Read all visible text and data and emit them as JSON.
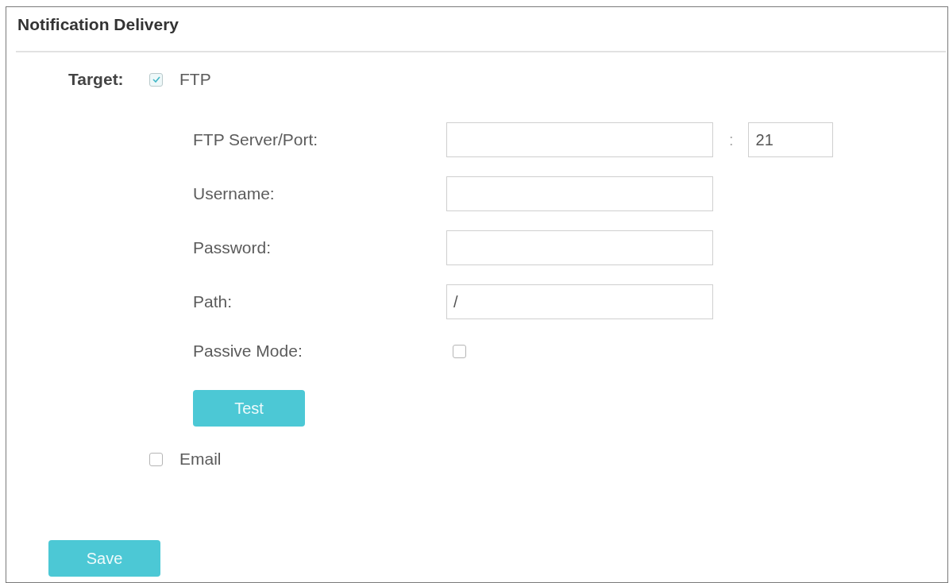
{
  "panel": {
    "title": "Notification Delivery"
  },
  "target": {
    "label": "Target:",
    "options": [
      {
        "label": "FTP",
        "checked": true,
        "fields": [
          {
            "kind": "server_port",
            "label": "FTP Server/Port:",
            "separator": ":",
            "port": "21"
          },
          {
            "kind": "text",
            "label": "Username:"
          },
          {
            "kind": "text",
            "label": "Password:"
          },
          {
            "kind": "text",
            "label": "Path:",
            "value": "/"
          },
          {
            "kind": "checkbox",
            "label": "Passive Mode:",
            "checked": false
          }
        ],
        "test_button": "Test"
      },
      {
        "label": "Email",
        "checked": false
      }
    ]
  },
  "save_button": "Save"
}
